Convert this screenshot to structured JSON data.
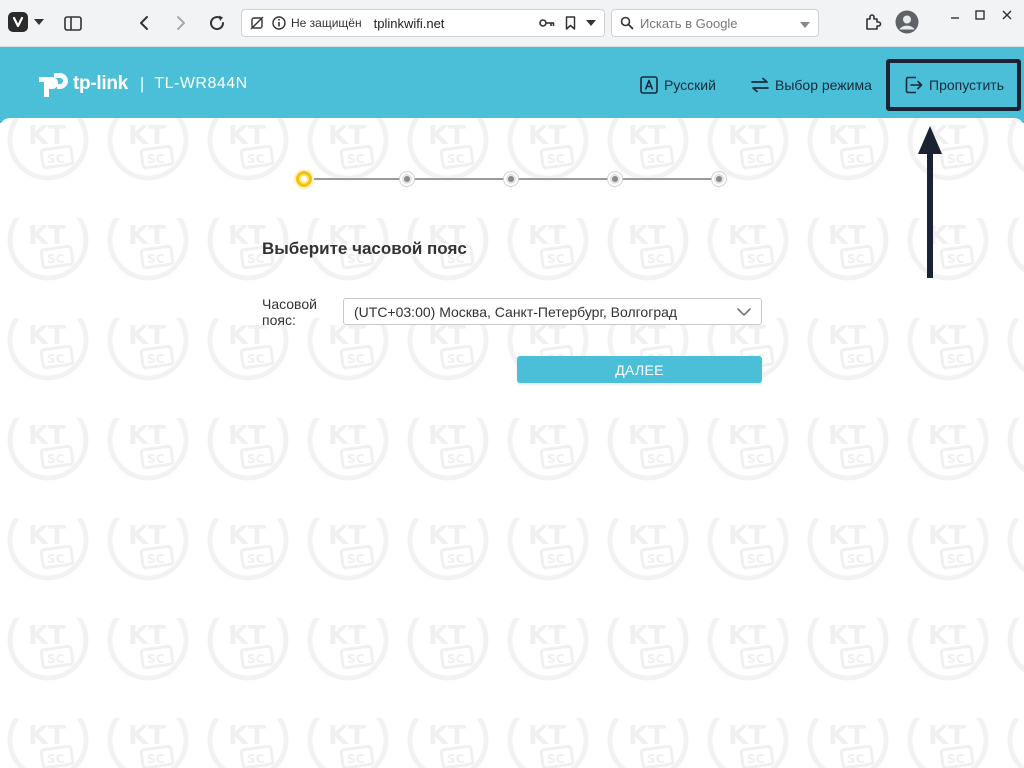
{
  "browser": {
    "security_label": "Не защищён",
    "url": "tplinkwifi.net",
    "search_placeholder": "Искать в Google"
  },
  "router": {
    "brand": "tp-link",
    "separator": "|",
    "model": "TL-WR844N",
    "header_links": {
      "language": "Русский",
      "mode": "Выбор режима",
      "skip": "Пропустить"
    }
  },
  "wizard": {
    "total_steps": 5,
    "current_step": 1,
    "heading": "Выберите часовой пояс",
    "timezone_label": "Часовой пояс:",
    "timezone_value": "(UTC+03:00) Москва, Санкт-Петербург, Волгоград",
    "next_label": "ДАЛЕЕ"
  },
  "colors": {
    "header_bg": "#4bbfd8",
    "button_bg": "#4bbfd8",
    "active_step": "#f4c20d",
    "annotation": "#1a2233"
  },
  "icons": [
    "vivaldi-logo-icon",
    "panel-icon",
    "back-icon",
    "forward-icon",
    "reload-icon",
    "not-secure-icon",
    "info-icon",
    "key-icon",
    "bookmark-icon",
    "search-icon",
    "extensions-icon",
    "profile-icon",
    "language-icon",
    "mode-switch-icon",
    "skip-icon",
    "chevron-down-icon"
  ]
}
